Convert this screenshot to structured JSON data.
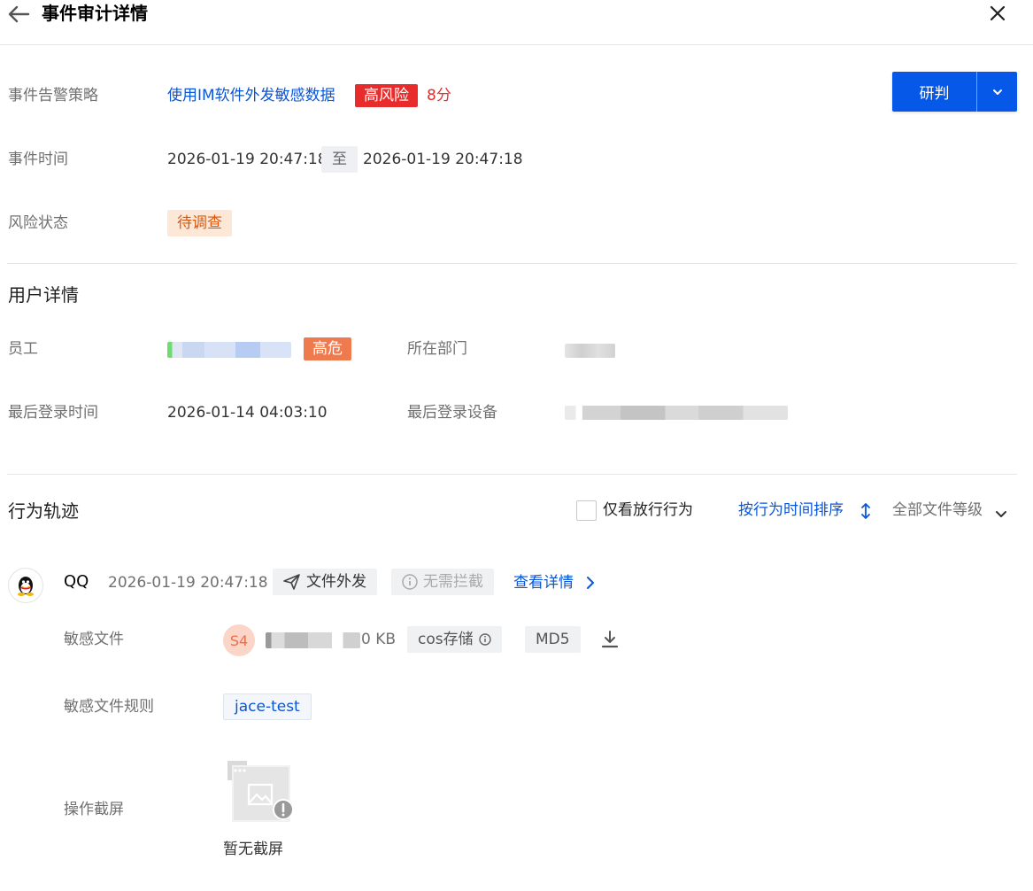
{
  "header": {
    "title": "事件审计详情",
    "back_icon": "arrow-left-icon",
    "close_icon": "close-icon"
  },
  "event": {
    "policy_label": "事件告警策略",
    "policy_value": "使用IM软件外发敏感数据",
    "risk_level": "高风险",
    "score": "8分",
    "time_label": "事件时间",
    "time_start": "2026-01-19 20:47:18",
    "time_sep": "至",
    "time_end": "2026-01-19 20:47:18",
    "status_label": "风险状态",
    "status_value": "待调查",
    "judge_button": "研判"
  },
  "user": {
    "section_title": "用户详情",
    "employee_label": "员工",
    "employee_tag": "高危",
    "department_label": "所在部门",
    "last_login_time_label": "最后登录时间",
    "last_login_time": "2026-01-14 04:03:10",
    "last_login_device_label": "最后登录设备"
  },
  "trace": {
    "section_title": "行为轨迹",
    "only_allowed_label": "仅看放行行为",
    "sort_label": "按行为时间排序",
    "file_level_label": "全部文件等级",
    "item": {
      "app": "QQ",
      "time": "2026-01-19 20:47:18",
      "action": "文件外发",
      "block_status": "无需拦截",
      "detail_link": "查看详情",
      "sensitive_file_label": "敏感文件",
      "file_badge": "S4",
      "file_size_tail": "0 KB",
      "storage_chip": "cos存储",
      "md5_chip": "MD5",
      "rule_label": "敏感文件规则",
      "rule_tag": "jace-test",
      "screenshot_label": "操作截屏",
      "no_screenshot": "暂无截屏"
    }
  },
  "colors": {
    "primary": "#0658e8",
    "link": "#0a56d9",
    "danger": "#e82c2c",
    "warning_bg": "#fde8d8",
    "warning_text": "#d9580f",
    "high_risk_user": "#ee7a4e"
  }
}
